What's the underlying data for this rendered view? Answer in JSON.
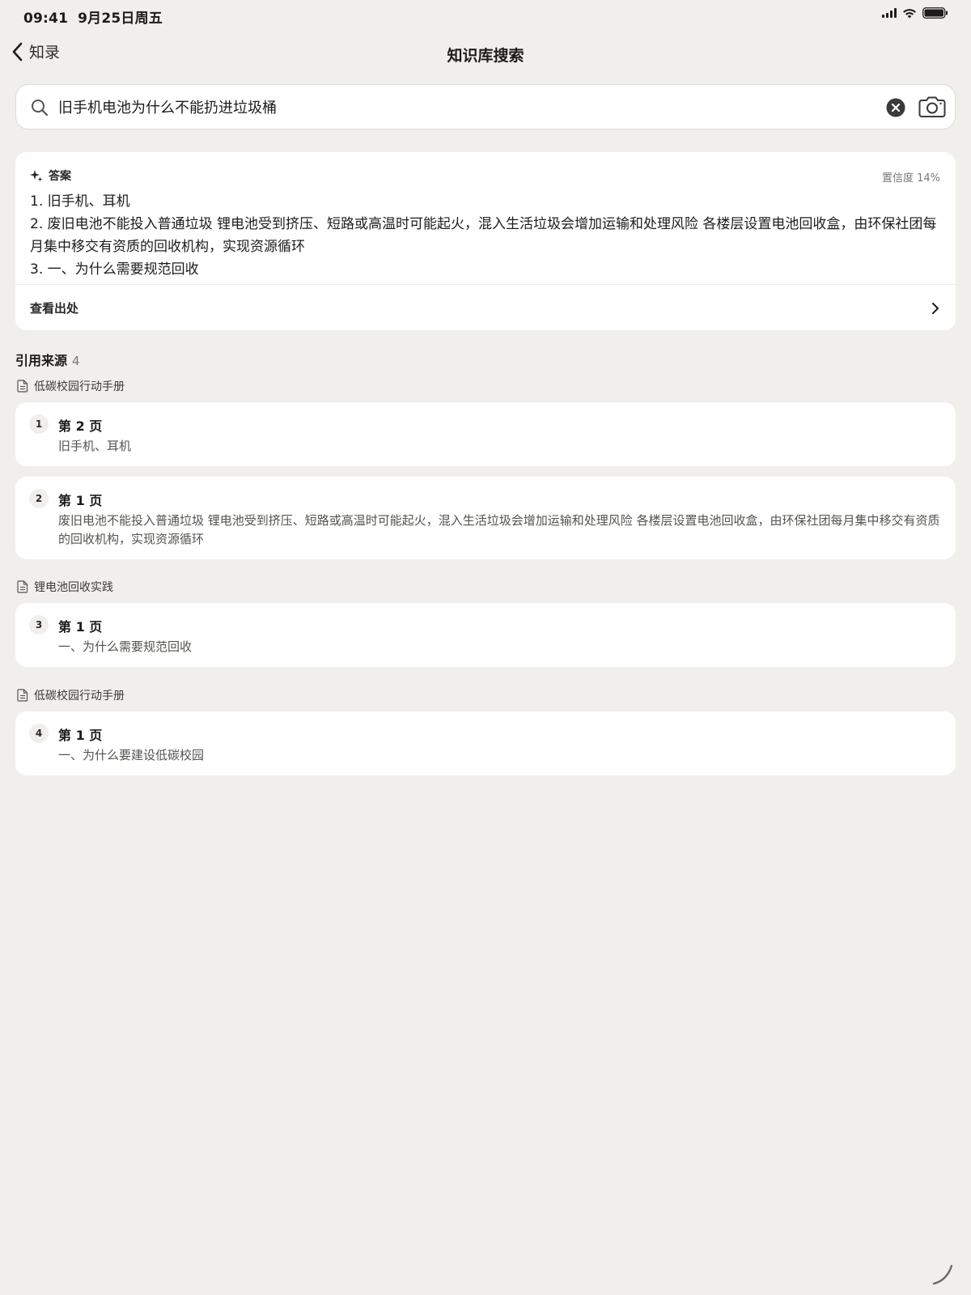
{
  "status_bar": {
    "time": "09:41",
    "date": "9月25日周五",
    "icons": [
      "signal-icon",
      "wifi-icon",
      "battery-icon"
    ]
  },
  "nav": {
    "back_label": "知录",
    "title": "知识库搜索"
  },
  "search": {
    "value": "旧手机电池为什么不能扔进垃圾桶",
    "icons": [
      "search-icon",
      "clear-icon",
      "camera-icon"
    ]
  },
  "answer": {
    "label": "答案",
    "confidence": "置信度 14%",
    "lines": [
      "1. 旧手机、耳机",
      "2. 废旧电池不能投入普通垃圾 锂电池受到挤压、短路或高温时可能起火，混入生活垃圾会增加运输和处理风险 各楼层设置电池回收盒，由环保社团每月集中移交有资质的回收机构，实现资源循环",
      "3. 一、为什么需要规范回收"
    ],
    "view_source": "查看出处"
  },
  "references": {
    "title": "引用来源",
    "count": "4",
    "groups": [
      {
        "doc": "低碳校园行动手册",
        "items": [
          {
            "num": "1",
            "page": "第 2 页",
            "snippet": "旧手机、耳机"
          },
          {
            "num": "2",
            "page": "第 1 页",
            "snippet": "废旧电池不能投入普通垃圾 锂电池受到挤压、短路或高温时可能起火，混入生活垃圾会增加运输和处理风险 各楼层设置电池回收盒，由环保社团每月集中移交有资质的回收机构，实现资源循环"
          }
        ]
      },
      {
        "doc": "锂电池回收实践",
        "items": [
          {
            "num": "3",
            "page": "第 1 页",
            "snippet": "一、为什么需要规范回收"
          }
        ]
      },
      {
        "doc": "低碳校园行动手册",
        "items": [
          {
            "num": "4",
            "page": "第 1 页",
            "snippet": "一、为什么要建设低碳校园"
          }
        ]
      }
    ]
  }
}
